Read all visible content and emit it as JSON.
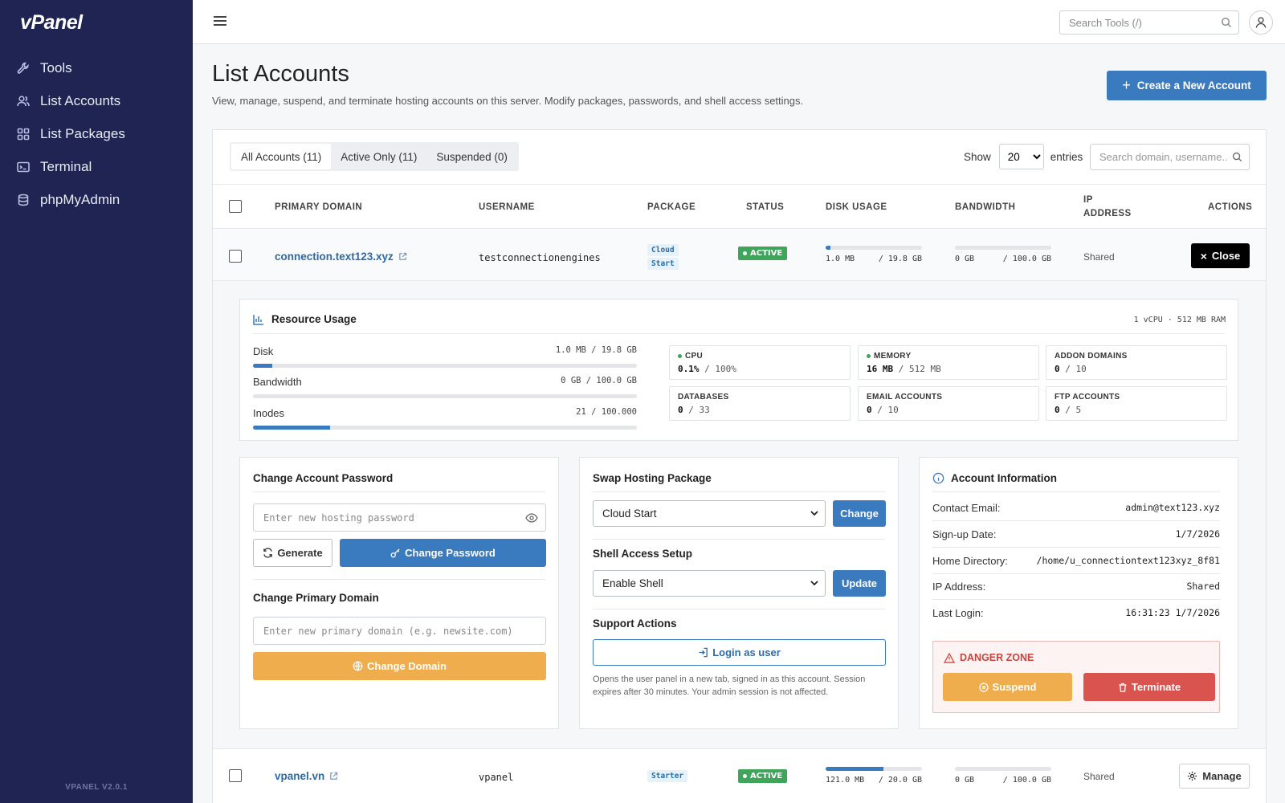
{
  "app": {
    "logo": "vPanel",
    "version": "VPANEL V2.0.1"
  },
  "sidebar": {
    "items": [
      {
        "label": "Tools",
        "icon": "wrench-icon"
      },
      {
        "label": "List Accounts",
        "icon": "users-icon"
      },
      {
        "label": "List Packages",
        "icon": "grid-icon"
      },
      {
        "label": "Terminal",
        "icon": "terminal-icon"
      },
      {
        "label": "phpMyAdmin",
        "icon": "database-icon"
      }
    ]
  },
  "topbar": {
    "search_placeholder": "Search Tools (/)"
  },
  "header": {
    "title": "List Accounts",
    "description": "View, manage, suspend, and terminate hosting accounts on this server. Modify packages, passwords, and shell access settings.",
    "create_label": "Create a New Account"
  },
  "table": {
    "tabs": [
      "All Accounts (11)",
      "Active Only (11)",
      "Suspended (0)"
    ],
    "show_label": "Show",
    "entries_value": "20",
    "entries_label": "entries",
    "search_placeholder": "Search domain, username...",
    "columns": [
      "PRIMARY DOMAIN",
      "USERNAME",
      "PACKAGE",
      "STATUS",
      "DISK USAGE",
      "BANDWIDTH",
      "IP",
      "ADDRESS",
      "ACTIONS"
    ],
    "rows": [
      {
        "domain": "connection.text123.xyz",
        "username": "testconnectionengines",
        "package_line1": "Cloud",
        "package_line2": "Start",
        "status": "ACTIVE",
        "disk_used": "1.0 MB",
        "disk_total": "/ 19.8 GB",
        "disk_pct": 0.05,
        "bw_used": "0 GB",
        "bw_total": "/ 100.0 GB",
        "bw_pct": 0,
        "ip": "Shared",
        "action": "Close"
      },
      {
        "domain": "vpanel.vn",
        "username": "vpanel",
        "package": "Starter",
        "status": "ACTIVE",
        "disk_used": "121.0 MB",
        "disk_total": "/ 20.0 GB",
        "disk_pct": 0.6,
        "bw_used": "0 GB",
        "bw_total": "/ 100.0 GB",
        "bw_pct": 0,
        "ip": "Shared",
        "action": "Manage"
      }
    ]
  },
  "details": {
    "resource": {
      "title": "Resource Usage",
      "spec": "1 vCPU · 512 MB RAM",
      "bars": [
        {
          "label": "Disk",
          "value": "1.0 MB / 19.8 GB",
          "pct": 0.05
        },
        {
          "label": "Bandwidth",
          "value": "0 GB / 100.0 GB",
          "pct": 0
        },
        {
          "label": "Inodes",
          "value": "21 / 100.000",
          "pct": 0.2
        }
      ],
      "stats": [
        {
          "label": "CPU",
          "value": "0.1%",
          "limit": "/ 100%",
          "dot": true
        },
        {
          "label": "MEMORY",
          "value": "16 MB",
          "limit": "/ 512 MB",
          "dot": true
        },
        {
          "label": "ADDON DOMAINS",
          "value": "0",
          "limit": "/ 10",
          "dot": false
        },
        {
          "label": "DATABASES",
          "value": "0",
          "limit": "/ 33",
          "dot": false
        },
        {
          "label": "EMAIL ACCOUNTS",
          "value": "0",
          "limit": "/ 10",
          "dot": false
        },
        {
          "label": "FTP ACCOUNTS",
          "value": "0",
          "limit": "/ 5",
          "dot": false
        }
      ]
    },
    "password": {
      "title": "Change Account Password",
      "placeholder": "Enter new hosting password",
      "generate_label": "Generate",
      "change_label": "Change Password"
    },
    "domain": {
      "title": "Change Primary Domain",
      "placeholder": "Enter new primary domain (e.g. newsite.com)",
      "change_label": "Change Domain"
    },
    "package": {
      "title": "Swap Hosting Package",
      "selected": "Cloud Start",
      "button": "Change"
    },
    "shell": {
      "title": "Shell Access Setup",
      "selected": "Enable Shell",
      "button": "Update"
    },
    "support": {
      "title": "Support Actions",
      "login_label": "Login as user",
      "note_line1": "Opens the user panel in a new tab, signed in as this account. Session",
      "note_line2": "expires after 30 minutes. Your admin session is not affected."
    },
    "info": {
      "title": "Account Information",
      "rows": [
        {
          "label": "Contact Email:",
          "value": "admin@text123.xyz"
        },
        {
          "label": "Sign-up Date:",
          "value": "1/7/2026"
        },
        {
          "label": "Home Directory:",
          "value": "/home/u_connectiontext123xyz_8f81"
        },
        {
          "label": "IP Address:",
          "value": "Shared"
        },
        {
          "label": "Last Login:",
          "value": "16:31:23 1/7/2026"
        }
      ],
      "danger_title": "DANGER ZONE",
      "suspend_label": "Suspend",
      "terminate_label": "Terminate"
    }
  },
  "colors": {
    "sidebar": "#1f2453",
    "primary": "#3a7bbf",
    "success": "#3fa55b",
    "warning": "#f0ad4e",
    "danger": "#d9534f"
  }
}
